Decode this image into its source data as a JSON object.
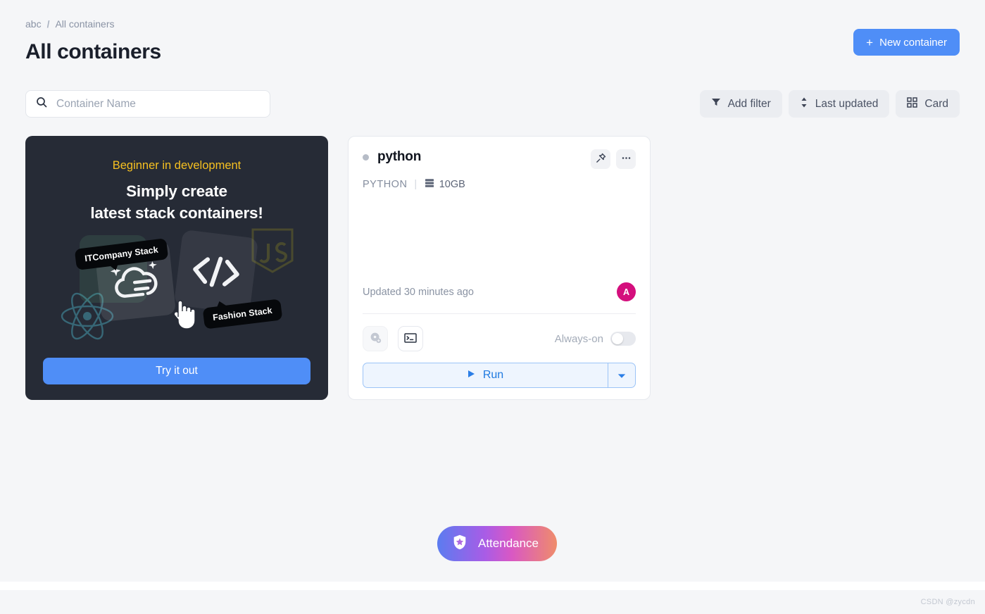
{
  "breadcrumb": {
    "root": "abc",
    "separator": "/",
    "current": "All containers"
  },
  "page": {
    "title": "All containers"
  },
  "header": {
    "new_container_label": "New container",
    "new_container_plus": "+",
    "accent_blue": "#4f8ef7"
  },
  "search": {
    "placeholder": "Container Name",
    "value": "",
    "icon": "search-icon"
  },
  "toolbar": {
    "add_filter_label": "Add filter",
    "sort_label": "Last updated",
    "view_label": "Card"
  },
  "promo": {
    "kicker": "Beginner in development",
    "headline_line1": "Simply create",
    "headline_line2": "latest stack containers!",
    "bubble_1": "ITCompany Stack",
    "bubble_2": "Fashion Stack",
    "cta_label": "Try it out",
    "kicker_color": "#f6c021",
    "background": "#262b36"
  },
  "container_card": {
    "status": "stopped",
    "status_color": "#b6bcc7",
    "name": "python",
    "stack": "PYTHON",
    "meta_divider": "|",
    "size": "10GB",
    "updated": "Updated 30 minutes ago",
    "avatar_initial": "A",
    "avatar_color": "#d40f7d",
    "pin_icon": "pin-icon",
    "more_icon": "more-options-icon",
    "snapshot_icon": "snapshot-add-icon",
    "terminal_icon": "terminal-icon",
    "always_on_label": "Always-on",
    "always_on_state": "off",
    "run_label": "Run",
    "run_caret": "chevron-down-icon"
  },
  "attendance": {
    "label": "Attendance",
    "icon": "shield-star-icon"
  },
  "watermark": {
    "text": "CSDN @zycdn"
  }
}
